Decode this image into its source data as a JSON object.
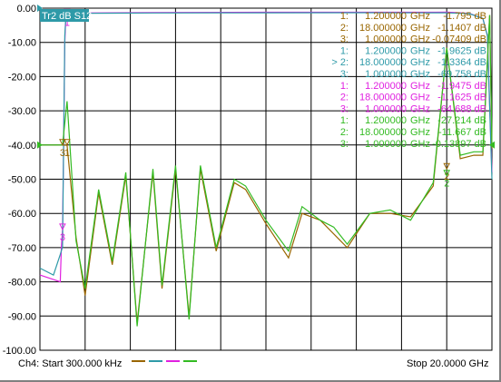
{
  "chart_data": {
    "type": "line",
    "title": "",
    "trace_tag": "Tr2 dB S12",
    "y_ticks": [
      "0.00",
      "-10.00",
      "-20.00",
      "-30.00",
      "-40.00",
      "-50.00",
      "-60.00",
      "-70.00",
      "-80.00",
      "-90.00",
      "-100.00"
    ],
    "ylim": [
      -100,
      0
    ],
    "x_start_label": "Ch4: Start  300.000 kHz",
    "x_stop_label": "Stop  20.0000 GHz",
    "xlim_ghz": [
      0.0003,
      20.0
    ],
    "grid": true,
    "colors": {
      "brown": "#996600",
      "teal": "#2e9aa8",
      "magenta": "#e020e0",
      "green": "#33bb22",
      "tag_bg": "#2e9aa8"
    },
    "series": [
      {
        "color_key": "magenta",
        "x": [
          0.0003,
          0.9,
          0.95,
          1.0,
          1.05,
          1.1,
          1.15,
          1.2,
          1.3,
          2.0,
          5.0,
          10.0,
          15.0,
          17.5,
          18.0,
          19.0,
          19.6,
          19.8,
          20.0
        ],
        "y": [
          -78,
          -80,
          -70,
          -64.7,
          -40,
          -10,
          -2,
          -1.95,
          -1.6,
          -1.4,
          -1.3,
          -1.2,
          -1.2,
          -1.2,
          -1.16,
          -1.5,
          -3,
          -8,
          -48
        ]
      },
      {
        "color_key": "teal",
        "x": [
          0.0003,
          0.6,
          0.9,
          1.0,
          1.05,
          1.1,
          1.15,
          1.2,
          1.3,
          2.0,
          5.0,
          10.0,
          15.0,
          17.5,
          18.0,
          19.0,
          19.6,
          19.8,
          20.0
        ],
        "y": [
          -76,
          -78,
          -72,
          -69.8,
          -40,
          -8,
          -2.2,
          -1.96,
          -1.6,
          -1.5,
          -1.4,
          -1.35,
          -1.33,
          -1.34,
          -1.34,
          -1.6,
          -3,
          -8,
          -50
        ]
      },
      {
        "color_key": "brown",
        "x": [
          0.0003,
          1.0,
          1.2,
          1.6,
          2.0,
          2.6,
          3.2,
          3.8,
          4.3,
          5.0,
          5.4,
          6.0,
          6.6,
          7.1,
          7.8,
          8.6,
          9.1,
          10.0,
          11.0,
          11.6,
          12.4,
          13.0,
          13.6,
          14.6,
          15.5,
          16.4,
          17.4,
          18.0,
          18.6,
          19.2,
          19.6,
          19.9,
          20.0
        ],
        "y": [
          -40,
          -40,
          -40.1,
          -67,
          -84,
          -54,
          -75,
          -49,
          -92,
          -48,
          -82,
          -47,
          -90,
          -47,
          -71,
          -51,
          -53,
          -63,
          -73,
          -60,
          -62,
          -66,
          -70,
          -60,
          -60,
          -61,
          -52,
          -11.5,
          -44,
          -43,
          -43,
          -2,
          -41
        ]
      },
      {
        "color_key": "green",
        "x": [
          0.0003,
          1.0,
          1.2,
          1.6,
          2.0,
          2.6,
          3.2,
          3.8,
          4.3,
          5.0,
          5.4,
          6.0,
          6.6,
          7.1,
          7.8,
          8.6,
          9.1,
          10.0,
          11.0,
          11.6,
          12.4,
          13.0,
          13.6,
          14.6,
          15.5,
          16.4,
          17.4,
          18.0,
          18.6,
          19.2,
          19.6,
          19.9,
          20.0
        ],
        "y": [
          -40,
          -40,
          -27.2,
          -68,
          -82,
          -53,
          -74,
          -48,
          -93,
          -47,
          -81,
          -46,
          -91,
          -46,
          -70,
          -50,
          -52,
          -62,
          -71,
          -58,
          -62,
          -64,
          -69,
          -60,
          -59,
          -62,
          -51,
          -11.7,
          -43,
          -42,
          -42,
          -2,
          -40
        ]
      }
    ],
    "marker_table": [
      {
        "color_key": "brown",
        "rows": [
          {
            "idx": "1:",
            "freq": "1.200000",
            "unit": "GHz",
            "val": "-1.795 dB"
          },
          {
            "idx": "2:",
            "freq": "18.000000",
            "unit": "GHz",
            "val": "-1.1407 dB"
          },
          {
            "idx": "3:",
            "freq": "1.000000",
            "unit": "GHz",
            "val": "-0.07409 dB"
          }
        ]
      },
      {
        "color_key": "teal",
        "rows": [
          {
            "idx": "1:",
            "freq": "1.200000",
            "unit": "GHz",
            "val": "-1.9625 dB"
          },
          {
            "idx": "> 2:",
            "freq": "18.000000",
            "unit": "GHz",
            "val": "-1.3364 dB"
          },
          {
            "idx": "3:",
            "freq": "1.000000",
            "unit": "GHz",
            "val": "-69.758 dB"
          }
        ]
      },
      {
        "color_key": "magenta",
        "rows": [
          {
            "idx": "1:",
            "freq": "1.200000",
            "unit": "GHz",
            "val": "-1.9475 dB"
          },
          {
            "idx": "2:",
            "freq": "18.000000",
            "unit": "GHz",
            "val": "-1.1625 dB"
          },
          {
            "idx": "3:",
            "freq": "1.000000",
            "unit": "GHz",
            "val": "-64.688 dB"
          }
        ]
      },
      {
        "color_key": "green",
        "rows": [
          {
            "idx": "1:",
            "freq": "1.200000",
            "unit": "GHz",
            "val": "-27.214 dB"
          },
          {
            "idx": "2:",
            "freq": "18.000000",
            "unit": "GHz",
            "val": "-11.667 dB"
          },
          {
            "idx": "3:",
            "freq": "1.000000",
            "unit": "GHz",
            "val": "-0.13897 dB"
          }
        ]
      }
    ],
    "markers": [
      {
        "label": "3",
        "color_key": "brown",
        "x": 1.0,
        "y": -40
      },
      {
        "label": "1",
        "color_key": "brown",
        "x": 1.2,
        "y": -40
      },
      {
        "label": "3",
        "color_key": "magenta",
        "x": 1.0,
        "y": -64.7
      },
      {
        "label": "1",
        "color_key": "magenta",
        "x": 1.2,
        "y": -1.95
      },
      {
        "label": "2",
        "color_key": "brown",
        "x": 18.0,
        "y": -47
      },
      {
        "label": "2",
        "color_key": "green",
        "x": 18.0,
        "y": -49
      }
    ],
    "legend_swatches": [
      "brown",
      "teal",
      "magenta",
      "green"
    ]
  }
}
